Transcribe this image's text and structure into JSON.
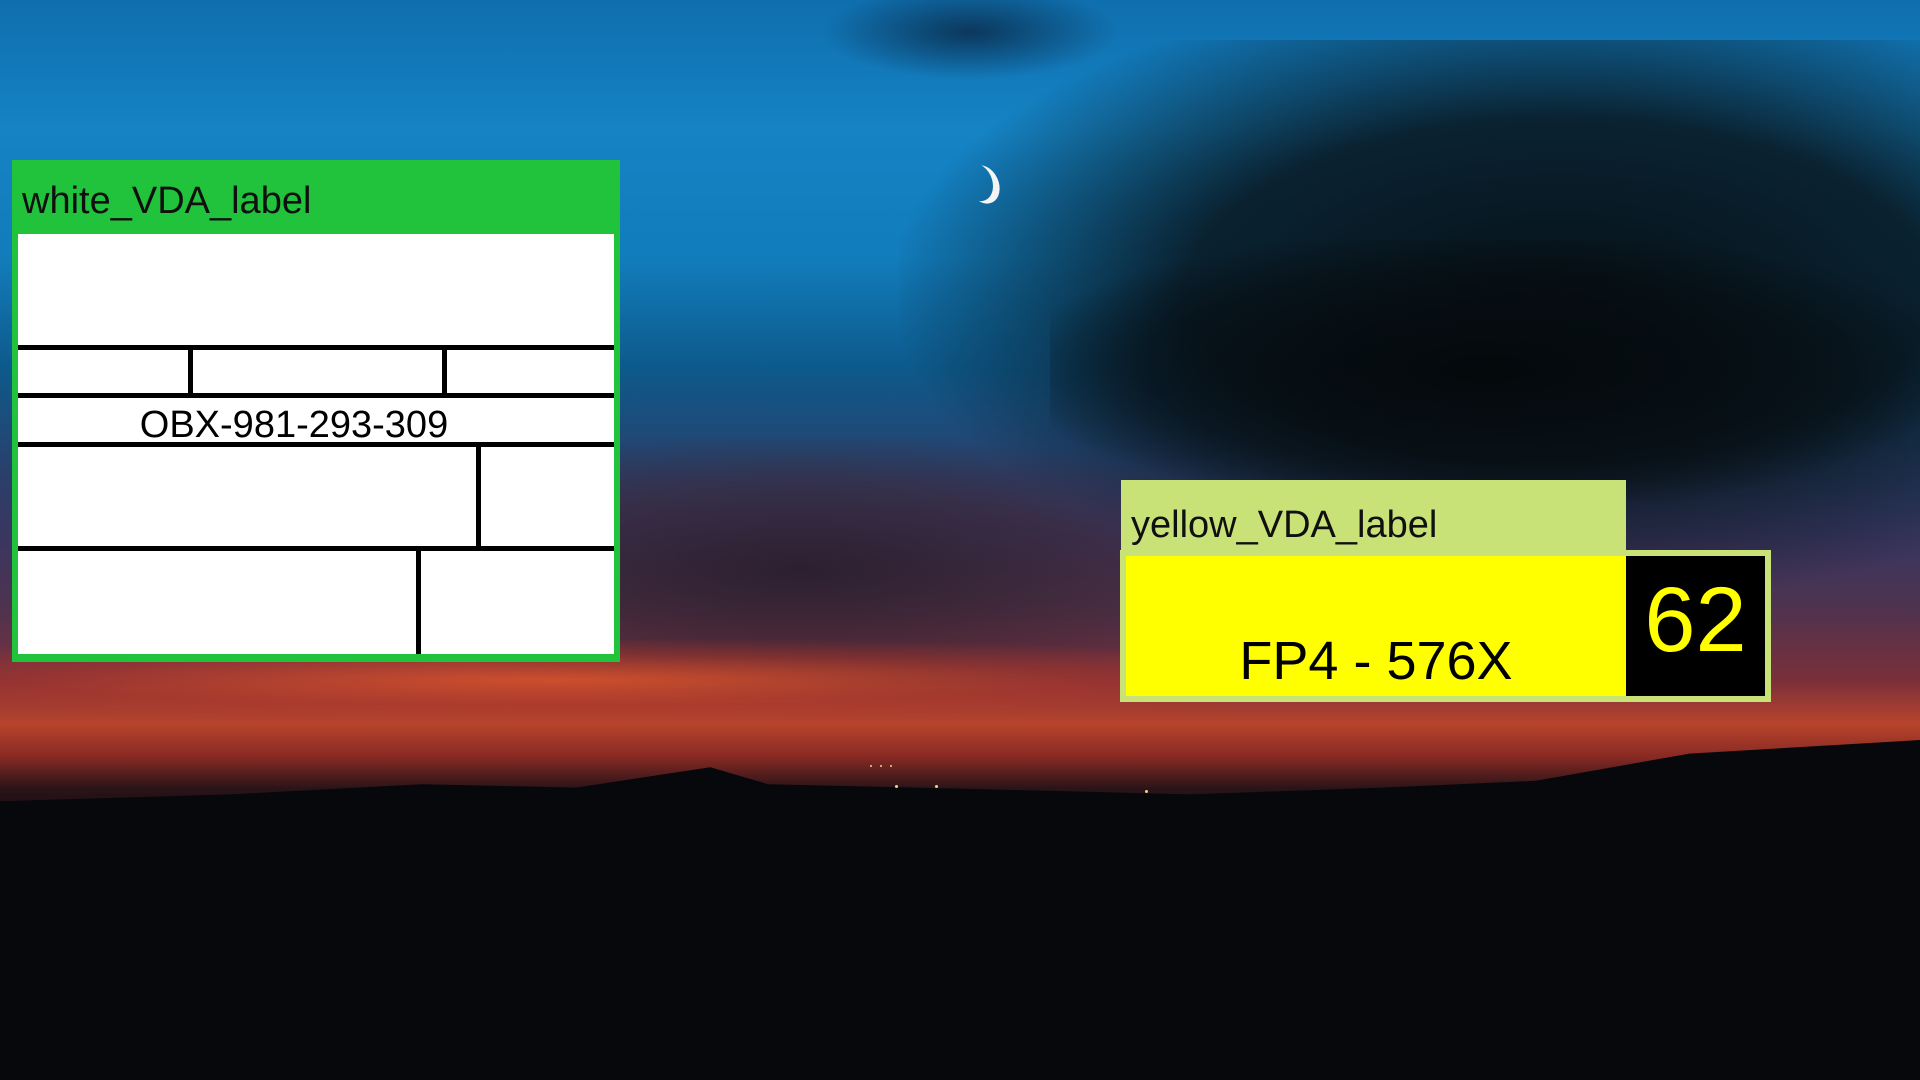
{
  "white_label": {
    "title": "white_VDA_label",
    "id_text": "OBX-981-293-309",
    "panel_color": "#21c23c"
  },
  "yellow_label": {
    "title": "yellow_VDA_label",
    "plate_text": "FP4 - 576X",
    "number": "62",
    "panel_color": "#c9e277",
    "field_color": "#ffff00"
  },
  "background": {
    "description_icon": "night-sky-crescent-moon"
  }
}
